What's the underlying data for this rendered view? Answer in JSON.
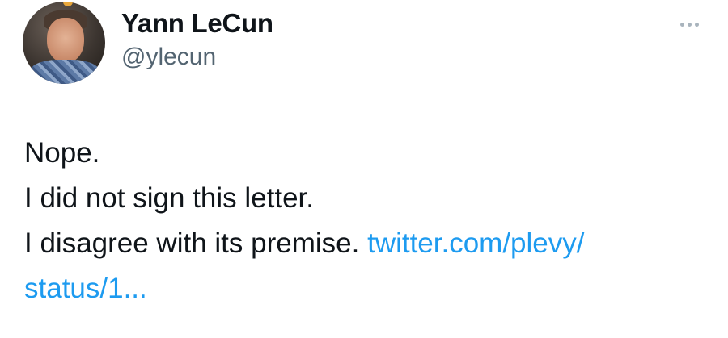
{
  "author": {
    "name": "Yann LeCun",
    "handle": "@ylecun"
  },
  "more_menu": {
    "icon": "more-dots-icon"
  },
  "tweet": {
    "line1": "Nope.",
    "line2": "I did not sign this letter.",
    "line3": "I disagree with its premise.",
    "link_part1": "twitter.com/plevy/",
    "link_part2": "status/1..."
  },
  "colors": {
    "text": "#0f1419",
    "secondary_text": "#536471",
    "link": "#1d9bf0"
  }
}
